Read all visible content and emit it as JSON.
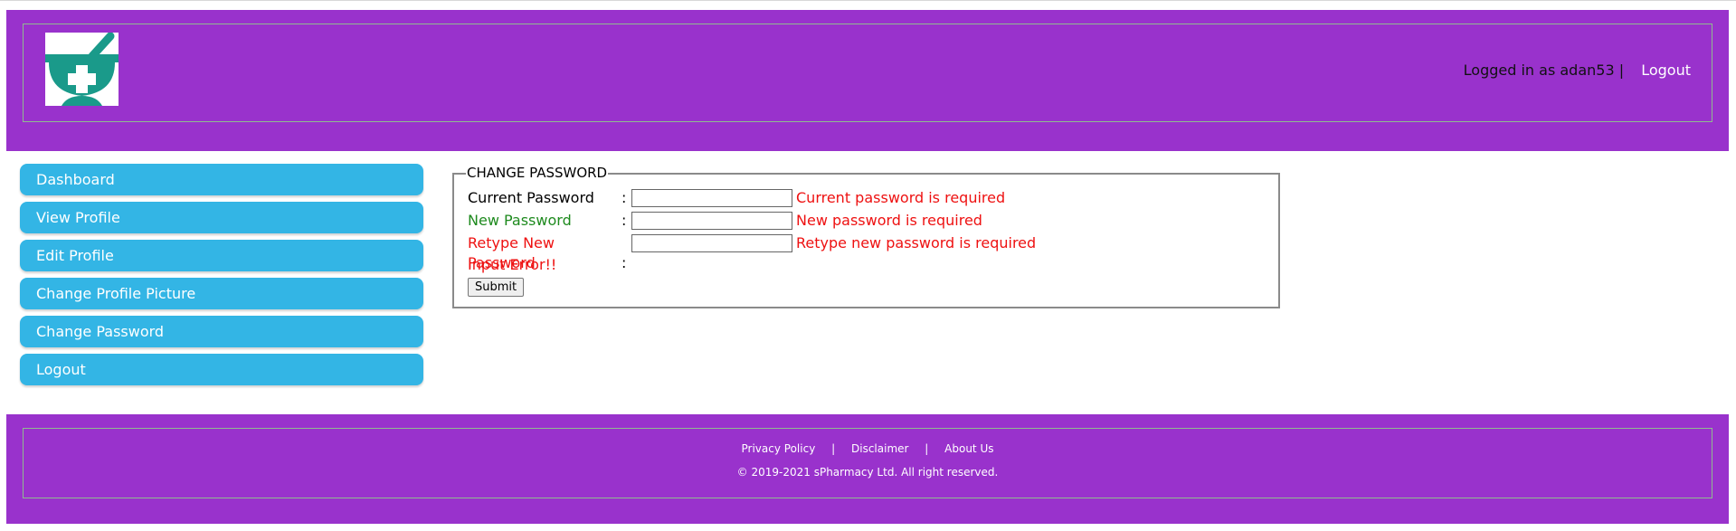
{
  "header": {
    "logo_icon": "pharmacy-mortar-cross-icon",
    "logged_in_text": "Logged in as adan53 |",
    "logout_label": "Logout",
    "bg_color": "#9932cc"
  },
  "sidebar": {
    "items": [
      {
        "label": "Dashboard"
      },
      {
        "label": "View Profile"
      },
      {
        "label": "Edit Profile"
      },
      {
        "label": "Change Profile Picture"
      },
      {
        "label": "Change Password"
      },
      {
        "label": "Logout"
      }
    ],
    "item_color": "#33b5e5"
  },
  "form": {
    "legend": "CHANGE PASSWORD",
    "fields": [
      {
        "label": "Current Password",
        "colon": ":",
        "value": "",
        "error": "Current password is required",
        "label_color": "black"
      },
      {
        "label": "New Password",
        "colon": ":",
        "value": "",
        "error": "New password is required",
        "label_color": "green"
      },
      {
        "label": "Retype New Password",
        "colon": ":",
        "value": "",
        "error": "Retype new password is required",
        "label_color": "red"
      }
    ],
    "input_error": "Input Error!!",
    "submit_label": "Submit"
  },
  "footer": {
    "links": [
      "Privacy Policy",
      "Disclaimer",
      "About Us"
    ],
    "separator": "|",
    "copyright": "© 2019-2021 sPharmacy Ltd. All right reserved."
  }
}
